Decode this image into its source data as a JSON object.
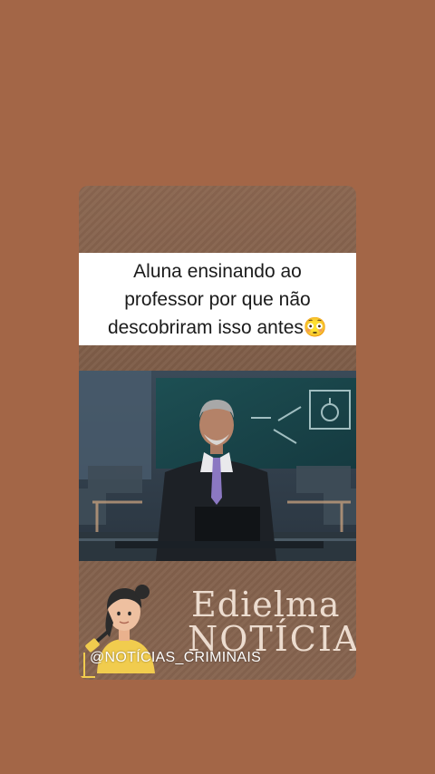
{
  "post": {
    "caption": "Aluna ensinando ao\nprofessor por que não\ndescobriram isso antes😳"
  },
  "brand": {
    "line1": "Edielma",
    "line2": "NOTÍCIA",
    "handle": "@NOTÍCIAS_CRIMINAIS"
  },
  "colors": {
    "page_bg": "#a36647",
    "caption_bg": "#ffffff",
    "brand_text": "#ecdccf"
  }
}
